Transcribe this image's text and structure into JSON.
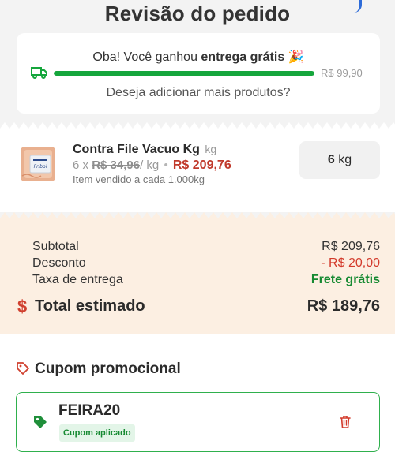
{
  "header": {
    "title": "Revisão do pedido"
  },
  "shipping": {
    "message_prefix": "Oba! Você ganhou ",
    "message_bold": "entrega grátis",
    "emoji": "🎉",
    "threshold": "R$ 99,90",
    "progress_fraction": 1.0,
    "add_more_link": "Deseja adicionar mais produtos?"
  },
  "product": {
    "name": "Contra File Vacuo Kg",
    "unit": "kg",
    "qty_prefix": "6 x",
    "unit_price": "R$ 34,96",
    "per_unit": "/ kg",
    "separator": "•",
    "total_price": "R$ 209,76",
    "note": "Item vendido a cada 1.000kg",
    "quantity_value": "6",
    "quantity_unit": "kg",
    "image_label": "Friboi"
  },
  "summary": {
    "subtotal_label": "Subtotal",
    "subtotal_value": "R$ 209,76",
    "discount_label": "Desconto",
    "discount_value": "- R$ 20,00",
    "delivery_label": "Taxa de entrega",
    "delivery_value": "Frete grátis",
    "total_label": "Total estimado",
    "total_value": "R$ 189,76",
    "currency_symbol": "$"
  },
  "coupon": {
    "title": "Cupom promocional",
    "code": "FEIRA20",
    "status": "Cupom aplicado"
  },
  "colors": {
    "accent_green": "#15a63c",
    "price_red": "#c0392b",
    "summary_bg": "#fcefe2",
    "link_blue": "#2d6bd8"
  }
}
